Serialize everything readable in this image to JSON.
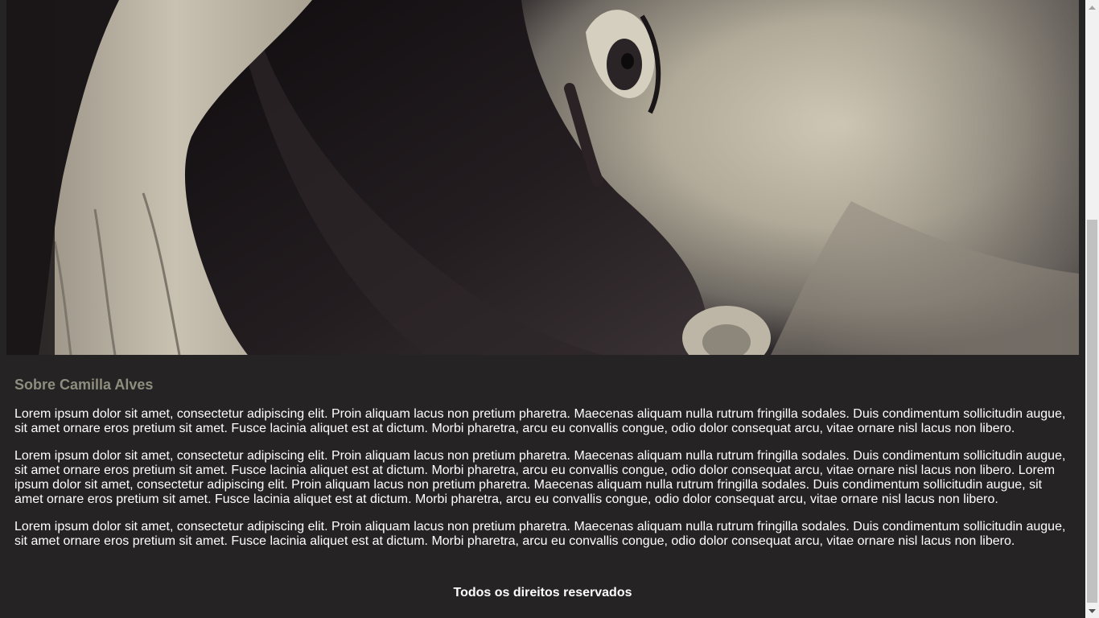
{
  "hero": {
    "image_name": "portrait-photo"
  },
  "about": {
    "heading": "Sobre Camilla Alves",
    "paragraphs": [
      "Lorem ipsum dolor sit amet, consectetur adipiscing elit. Proin aliquam lacus non pretium pharetra. Maecenas aliquam nulla rutrum fringilla sodales. Duis condimentum sollicitudin augue, sit amet ornare eros pretium sit amet. Fusce lacinia aliquet est at dictum. Morbi pharetra, arcu eu convallis congue, odio dolor consequat arcu, vitae ornare nisl lacus non libero.",
      "Lorem ipsum dolor sit amet, consectetur adipiscing elit. Proin aliquam lacus non pretium pharetra. Maecenas aliquam nulla rutrum fringilla sodales. Duis condimentum sollicitudin augue, sit amet ornare eros pretium sit amet. Fusce lacinia aliquet est at dictum. Morbi pharetra, arcu eu convallis congue, odio dolor consequat arcu, vitae ornare nisl lacus non libero. Lorem ipsum dolor sit amet, consectetur adipiscing elit. Proin aliquam lacus non pretium pharetra. Maecenas aliquam nulla rutrum fringilla sodales. Duis condimentum sollicitudin augue, sit amet ornare eros pretium sit amet. Fusce lacinia aliquet est at dictum. Morbi pharetra, arcu eu convallis congue, odio dolor consequat arcu, vitae ornare nisl lacus non libero.",
      "Lorem ipsum dolor sit amet, consectetur adipiscing elit. Proin aliquam lacus non pretium pharetra. Maecenas aliquam nulla rutrum fringilla sodales. Duis condimentum sollicitudin augue, sit amet ornare eros pretium sit amet. Fusce lacinia aliquet est at dictum. Morbi pharetra, arcu eu convallis congue, odio dolor consequat arcu, vitae ornare nisl lacus non libero."
    ]
  },
  "footer": {
    "text": "Todos os direitos reservados"
  },
  "colors": {
    "background": "#252324",
    "heading": "#8f8d7e",
    "text": "#ffffff"
  }
}
